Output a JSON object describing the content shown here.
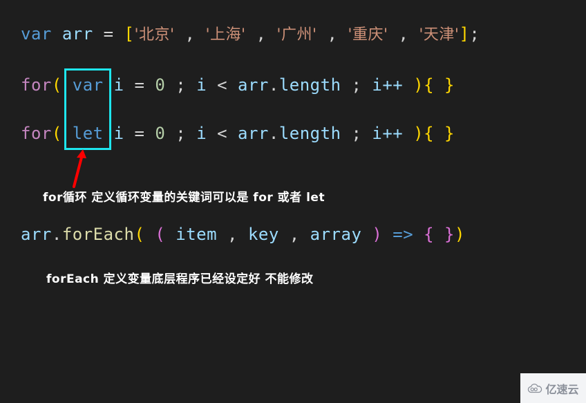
{
  "editor": {
    "background_color": "#1e1e1e",
    "language": "JavaScript",
    "lines": [
      {
        "id": "line-1",
        "text": "var arr = ['北京' , '上海' , '广州' , '重庆' , '天津'];",
        "tokens": [
          {
            "text": "var",
            "type": "keyword"
          },
          {
            "text": " ",
            "type": "plain"
          },
          {
            "text": "arr",
            "type": "variable"
          },
          {
            "text": " = ",
            "type": "plain"
          },
          {
            "text": "[",
            "type": "bracket-yellow"
          },
          {
            "text": "'北京'",
            "type": "string"
          },
          {
            "text": " , ",
            "type": "plain"
          },
          {
            "text": "'上海'",
            "type": "string"
          },
          {
            "text": " , ",
            "type": "plain"
          },
          {
            "text": "'广州'",
            "type": "string"
          },
          {
            "text": " , ",
            "type": "plain"
          },
          {
            "text": "'重庆'",
            "type": "string"
          },
          {
            "text": " , ",
            "type": "plain"
          },
          {
            "text": "'天津'",
            "type": "string"
          },
          {
            "text": "]",
            "type": "bracket-yellow"
          },
          {
            "text": ";",
            "type": "plain"
          }
        ]
      },
      {
        "id": "line-2",
        "text": "for( var i = 0 ; i < arr.length ; i++ ){ }"
      },
      {
        "id": "line-3",
        "text": "for( let i = 0 ; i < arr.length ; i++ ){ }"
      },
      {
        "id": "line-4",
        "text": "arr.forEach( ( item , key , array ) => { })"
      }
    ],
    "line1": {
      "kw_var": "var",
      "name_arr": "arr",
      "assign": " = ",
      "bracket_open": "[",
      "s1": "'北京'",
      "sep1": " , ",
      "s2": "'上海'",
      "sep2": " , ",
      "s3": "'广州'",
      "sep3": " , ",
      "s4": "'重庆'",
      "sep4": " , ",
      "s5": "'天津'",
      "bracket_close": "]",
      "semicolon": ";"
    },
    "line2": {
      "kw_for": "for",
      "paren_open": "(",
      "kw_decl": "var",
      "i1": "i",
      "eq": " = ",
      "zero": "0",
      "semi1": " ; ",
      "i2": "i",
      "lt": " < ",
      "obj": "arr",
      "dot": ".",
      "prop": "length",
      "semi2": " ; ",
      "incr": "i++",
      "paren_close": ")",
      "brace": "{ }"
    },
    "line3": {
      "kw_for": "for",
      "paren_open": "(",
      "kw_decl": "let",
      "i1": "i",
      "eq": " = ",
      "zero": "0",
      "semi1": " ; ",
      "i2": "i",
      "lt": " < ",
      "obj": "arr",
      "dot": ".",
      "prop": "length",
      "semi2": " ; ",
      "incr": "i++",
      "paren_close": ")",
      "brace": "{ }"
    },
    "line4": {
      "obj": "arr",
      "dot": ".",
      "method": "forEach",
      "paren_open": "(",
      "inner_paren_open": "(",
      "p1": "item",
      "sep1": " , ",
      "p2": "key",
      "sep2": " , ",
      "p3": "array",
      "inner_paren_close": ")",
      "arrow": "=>",
      "brace_open": "{",
      "brace_close": "}",
      "paren_close": ")"
    }
  },
  "highlight": {
    "color": "#1ee6ee",
    "targets": [
      "var",
      "let"
    ],
    "arrow_color": "#ff0000"
  },
  "annotations": [
    {
      "id": "annotation-1",
      "text": "for循环 定义循环变量的关键词可以是 for 或者 let"
    },
    {
      "id": "annotation-2",
      "text": "forEach 定义变量底层程序已经设定好 不能修改"
    }
  ],
  "watermark": {
    "label": "亿速云",
    "icon": "cloud-icon",
    "background_color": "#f3f4f6",
    "text_color": "#8a8f99"
  },
  "colors": {
    "background": "#1e1e1e",
    "keyword": "#569cd6",
    "control": "#c586c0",
    "variable": "#9cdcfe",
    "string": "#ce9178",
    "number": "#b5cea8",
    "function": "#dcdcaa",
    "plain": "#d4d4d4",
    "bracket_yellow": "#ffd700",
    "bracket_magenta": "#da70d6",
    "highlight_cyan": "#1ee6ee",
    "arrow_red": "#ff0000"
  }
}
